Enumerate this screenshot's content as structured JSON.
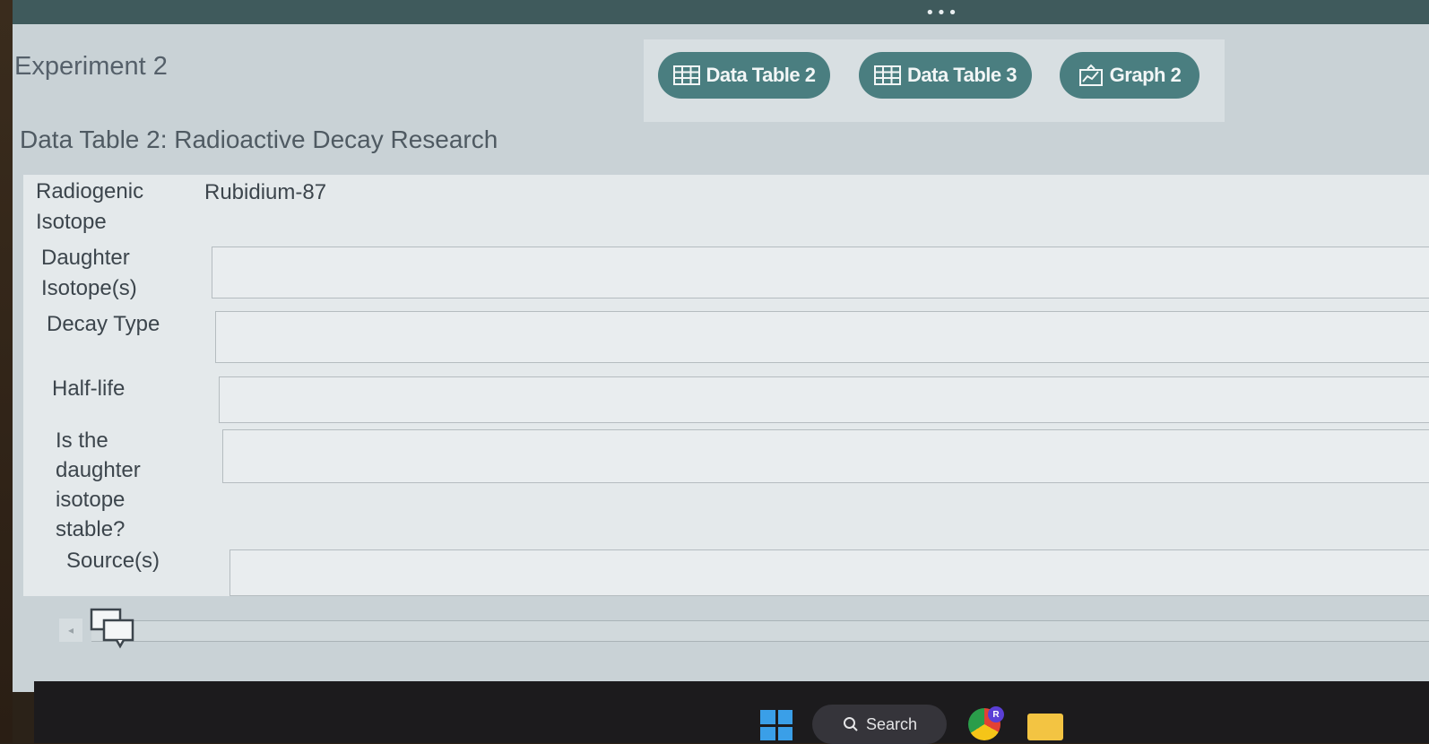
{
  "window": {
    "menu_dots": "•••"
  },
  "experiment": {
    "title": "Experiment 2"
  },
  "toolbar": {
    "buttons": [
      {
        "label": "Data Table 2",
        "icon": "table-icon"
      },
      {
        "label": "Data Table 3",
        "icon": "table-icon"
      },
      {
        "label": "Graph 2",
        "icon": "graph-icon"
      }
    ]
  },
  "table": {
    "title": "Data Table 2: Radioactive Decay Research",
    "rows": [
      {
        "label_lines": [
          "Radiogenic",
          "Isotope"
        ],
        "value": "Rubidium-87"
      },
      {
        "label_lines": [
          "Daughter",
          "Isotope(s)"
        ],
        "value": ""
      },
      {
        "label_lines": [
          "Decay Type"
        ],
        "value": ""
      },
      {
        "label_lines": [
          "Half-life"
        ],
        "value": ""
      },
      {
        "label_lines": [
          "Is the",
          "daughter",
          "isotope",
          "stable?"
        ],
        "value": ""
      },
      {
        "label_lines": [
          "Source(s)"
        ],
        "value": ""
      }
    ]
  },
  "taskbar": {
    "search_label": "Search",
    "chrome_badge": "R"
  }
}
